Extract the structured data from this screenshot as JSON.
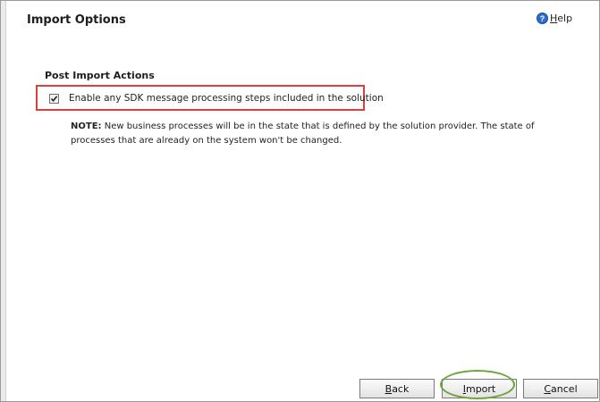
{
  "dialog": {
    "title": "Import Options",
    "help": {
      "first": "H",
      "rest": "elp"
    }
  },
  "post_import": {
    "heading": "Post Import Actions",
    "checkbox_label": "Enable any SDK message processing steps included in the solution",
    "checked": true
  },
  "note": {
    "prefix": "NOTE:",
    "text": " New business processes will be in the state that is defined by the solution provider. The state of processes that are already on the system won't be changed."
  },
  "buttons": {
    "back": {
      "first": "B",
      "rest": "ack"
    },
    "import": {
      "first": "I",
      "rest": "mport"
    },
    "cancel": {
      "first": "C",
      "rest": "ancel"
    }
  },
  "colors": {
    "highlight_red": "#dc3f3f",
    "highlight_green": "#6ea53b",
    "help_icon_blue": "#2a6bd1"
  },
  "icons": {
    "help": "question-circle-icon",
    "check": "checkmark-icon"
  }
}
